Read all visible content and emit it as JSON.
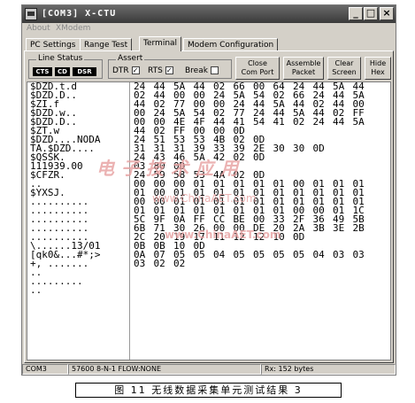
{
  "window": {
    "title": "[COM3] X-CTU"
  },
  "menu": [
    "About",
    "XModem"
  ],
  "tabs": [
    "PC Settings",
    "Range Test",
    "Terminal",
    "Modem Configuration"
  ],
  "line_status": {
    "title": "Line Status",
    "indicators": [
      "CTS",
      "CD",
      "DSR"
    ]
  },
  "assert": {
    "title": "Assert",
    "checks": [
      {
        "label": "DTR",
        "checked": true
      },
      {
        "label": "RTS",
        "checked": true
      },
      {
        "label": "Break",
        "checked": false
      }
    ]
  },
  "buttons": {
    "close": [
      "Close",
      "Com Port"
    ],
    "assemble": [
      "Assemble",
      "Packet"
    ],
    "clear": [
      "Clear",
      "Screen"
    ],
    "hide": [
      "Hide",
      "Hex"
    ]
  },
  "terminal": {
    "ascii": [
      "$DZD.t.d",
      "$DZD.D..",
      "$ZI.f",
      "$DZD.w..",
      "$DZD.D..",
      "$ZT.w",
      "$DZD....NODA",
      "TA.$DZD....",
      "$QSSK.",
      "111939.00",
      "$CFZR.",
      "..",
      "$YXSJ.",
      "..........",
      "..........",
      "..........",
      "..........",
      "..........",
      "\\......13/01",
      "[qk0&...#*;>",
      "+, .......",
      "..",
      ".........",
      ".."
    ],
    "hex": [
      [
        "24",
        "44",
        "5A",
        "44",
        "02",
        "66",
        "00",
        "64",
        "24",
        "44",
        "5A",
        "44"
      ],
      [
        "02",
        "44",
        "00",
        "00",
        "24",
        "5A",
        "54",
        "02",
        "66",
        "24",
        "44",
        "5A"
      ],
      [
        "44",
        "02",
        "77",
        "00",
        "00",
        "24",
        "44",
        "5A",
        "44",
        "02",
        "44",
        "00"
      ],
      [
        "00",
        "24",
        "5A",
        "54",
        "02",
        "77",
        "24",
        "44",
        "5A",
        "44",
        "02",
        "FF"
      ],
      [
        "00",
        "00",
        "4E",
        "4F",
        "44",
        "41",
        "54",
        "41",
        "02",
        "24",
        "44",
        "5A"
      ],
      [
        "44",
        "02",
        "FF",
        "00",
        "00",
        "0D"
      ],
      [
        "24",
        "51",
        "53",
        "53",
        "4B",
        "02",
        "0D"
      ],
      [
        "31",
        "31",
        "31",
        "39",
        "33",
        "39",
        "2E",
        "30",
        "30",
        "0D"
      ],
      [
        "24",
        "43",
        "46",
        "5A",
        "42",
        "02",
        "0D"
      ],
      [
        "03",
        "80",
        "0D"
      ],
      [
        "24",
        "59",
        "58",
        "53",
        "4A",
        "02",
        "0D"
      ],
      [
        "00",
        "00",
        "00",
        "01",
        "01",
        "01",
        "01",
        "01",
        "00",
        "01",
        "01",
        "01"
      ],
      [
        "01",
        "00",
        "01",
        "01",
        "01",
        "01",
        "01",
        "01",
        "01",
        "01",
        "01",
        "01"
      ],
      [
        "00",
        "00",
        "01",
        "01",
        "01",
        "01",
        "01",
        "01",
        "01",
        "01",
        "01",
        "01"
      ],
      [
        "01",
        "01",
        "01",
        "01",
        "01",
        "01",
        "01",
        "01",
        "00",
        "00",
        "01",
        "1C"
      ],
      [
        "5C",
        "9F",
        "0A",
        "FF",
        "CC",
        "BE",
        "00",
        "33",
        "2F",
        "36",
        "49",
        "5B"
      ],
      [
        "6B",
        "71",
        "30",
        "26",
        "00",
        "00",
        "DE",
        "20",
        "2A",
        "3B",
        "3E",
        "2B"
      ],
      [
        "2C",
        "20",
        "19",
        "17",
        "11",
        "12",
        "12",
        "10",
        "0D"
      ],
      [
        "0B",
        "0B",
        "10",
        "0D"
      ],
      [
        "0A",
        "07",
        "05",
        "05",
        "04",
        "05",
        "05",
        "05",
        "05",
        "04",
        "03",
        "03"
      ],
      [
        "03",
        "02",
        "02"
      ]
    ]
  },
  "status": {
    "port": "COM3",
    "settings": "57600 8-N-1  FLOW:NONE",
    "rx": "Rx: 152 bytes"
  },
  "watermark": {
    "main": "电子技术应用",
    "sub": "www.ChinaAET.com",
    "url": "www.ChinaAET.com"
  },
  "caption": "图 11  无线数据采集单元测试结果 3"
}
